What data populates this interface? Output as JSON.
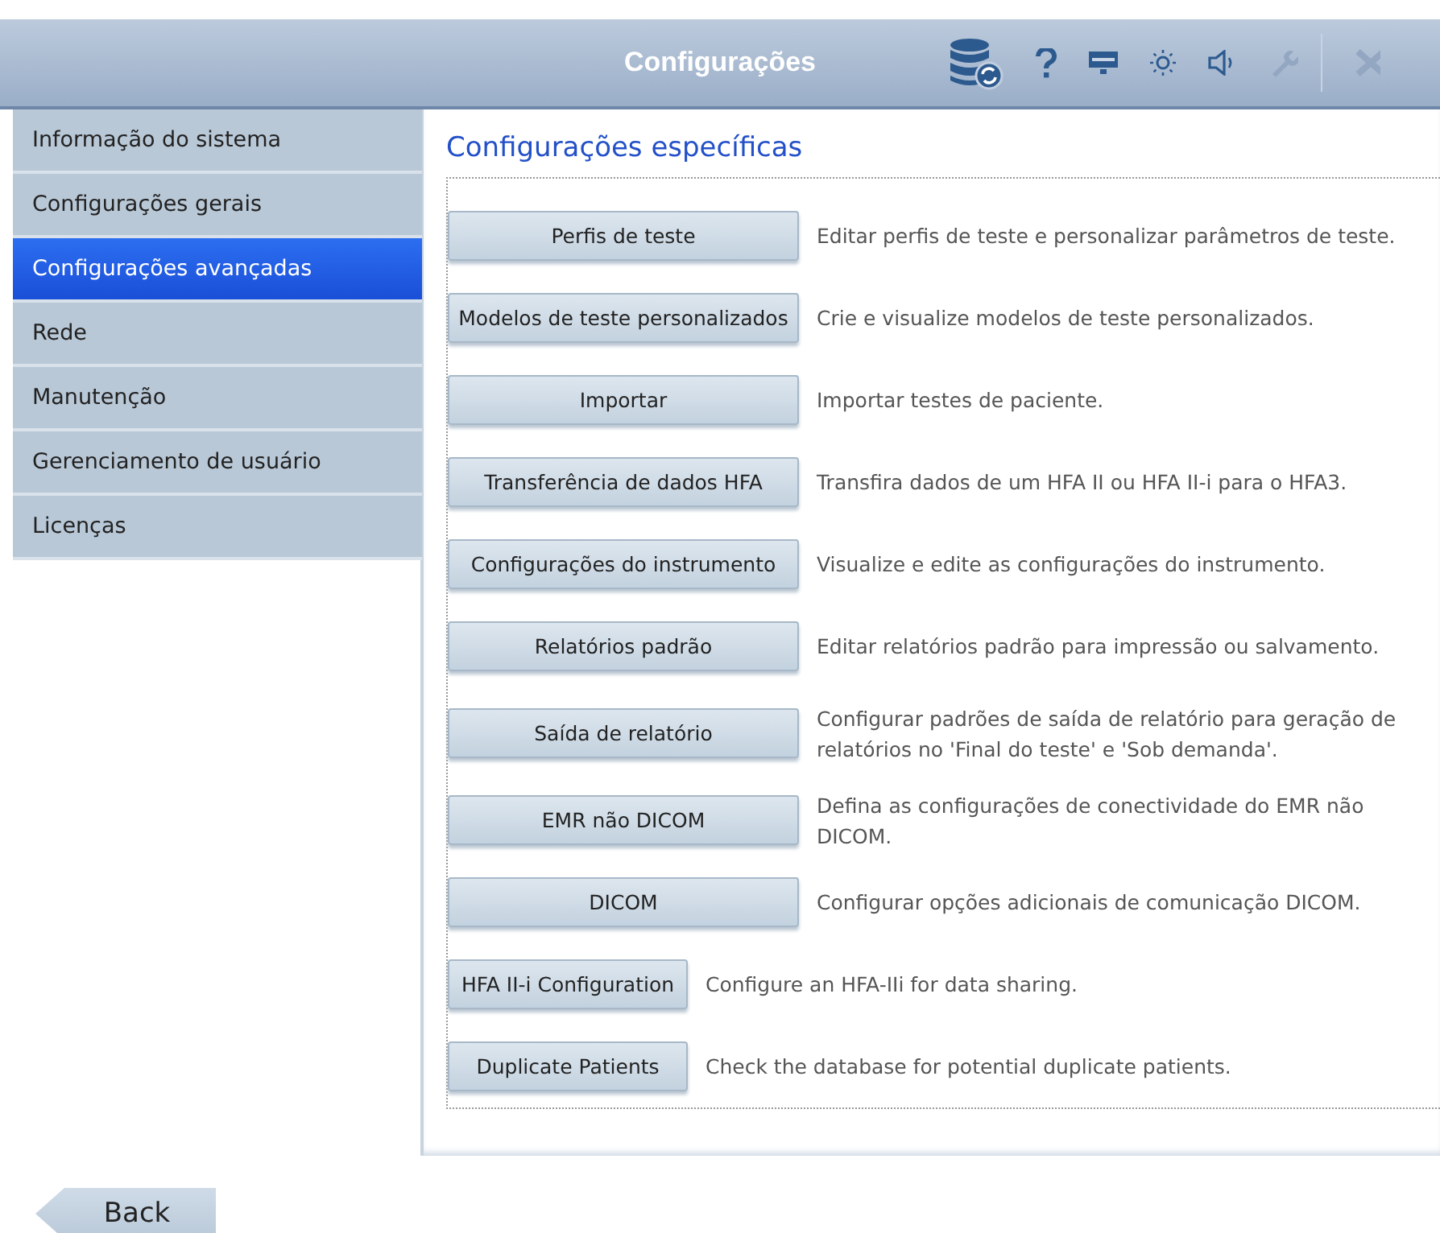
{
  "window": {
    "title": "Configurações"
  },
  "toolbar": [
    {
      "kind": "database-sync",
      "disabled": false
    },
    {
      "kind": "help",
      "disabled": false
    },
    {
      "kind": "monitor",
      "disabled": false
    },
    {
      "kind": "brightness",
      "disabled": false
    },
    {
      "kind": "volume",
      "disabled": false
    },
    {
      "kind": "wrench",
      "disabled": true
    },
    {
      "kind": "close",
      "disabled": true
    }
  ],
  "sidebar": {
    "items": [
      {
        "label": "Informação do sistema",
        "selected": false
      },
      {
        "label": "Configurações gerais",
        "selected": false
      },
      {
        "label": "Configurações avançadas",
        "selected": true
      },
      {
        "label": "Rede",
        "selected": false
      },
      {
        "label": "Manutenção",
        "selected": false
      },
      {
        "label": "Gerenciamento de usuário",
        "selected": false
      },
      {
        "label": "Licenças",
        "selected": false
      }
    ]
  },
  "content": {
    "heading": "Configurações específicas",
    "options": [
      {
        "kind": "wide",
        "button": "Perfis de teste",
        "description": "Editar perfis de teste e personalizar parâmetros de teste."
      },
      {
        "kind": "wide",
        "button": "Modelos de teste personalizados",
        "description": "Crie e visualize modelos de teste personalizados."
      },
      {
        "kind": "wide",
        "button": "Importar",
        "description": "Importar testes de paciente."
      },
      {
        "kind": "wide",
        "button": "Transferência de dados HFA",
        "description": "Transfira dados de um HFA II ou HFA II-i para o HFA3."
      },
      {
        "kind": "wide",
        "button": "Configurações do instrumento",
        "description": "Visualize e edite as configurações do instrumento."
      },
      {
        "kind": "wide",
        "button": "Relatórios padrão",
        "description": "Editar relatórios padrão para impressão ou salvamento."
      },
      {
        "kind": "wide",
        "button": "Saída de relatório",
        "description": "Configurar padrões de saída de relatório para geração de relatórios no 'Final do teste' e 'Sob demanda'."
      },
      {
        "kind": "wide",
        "button": "EMR não DICOM",
        "description": "Defina as configurações de conectividade do EMR não DICOM."
      },
      {
        "kind": "wide",
        "button": "DICOM",
        "description": "Configurar opções adicionais de comunicação DICOM."
      },
      {
        "kind": "compact",
        "button": "HFA II-i Configuration",
        "description": "Configure an HFA-IIi for data sharing."
      },
      {
        "kind": "compact",
        "button": "Duplicate Patients",
        "description": "Check the database for potential duplicate patients."
      }
    ]
  },
  "back_button": {
    "label": "Back"
  }
}
